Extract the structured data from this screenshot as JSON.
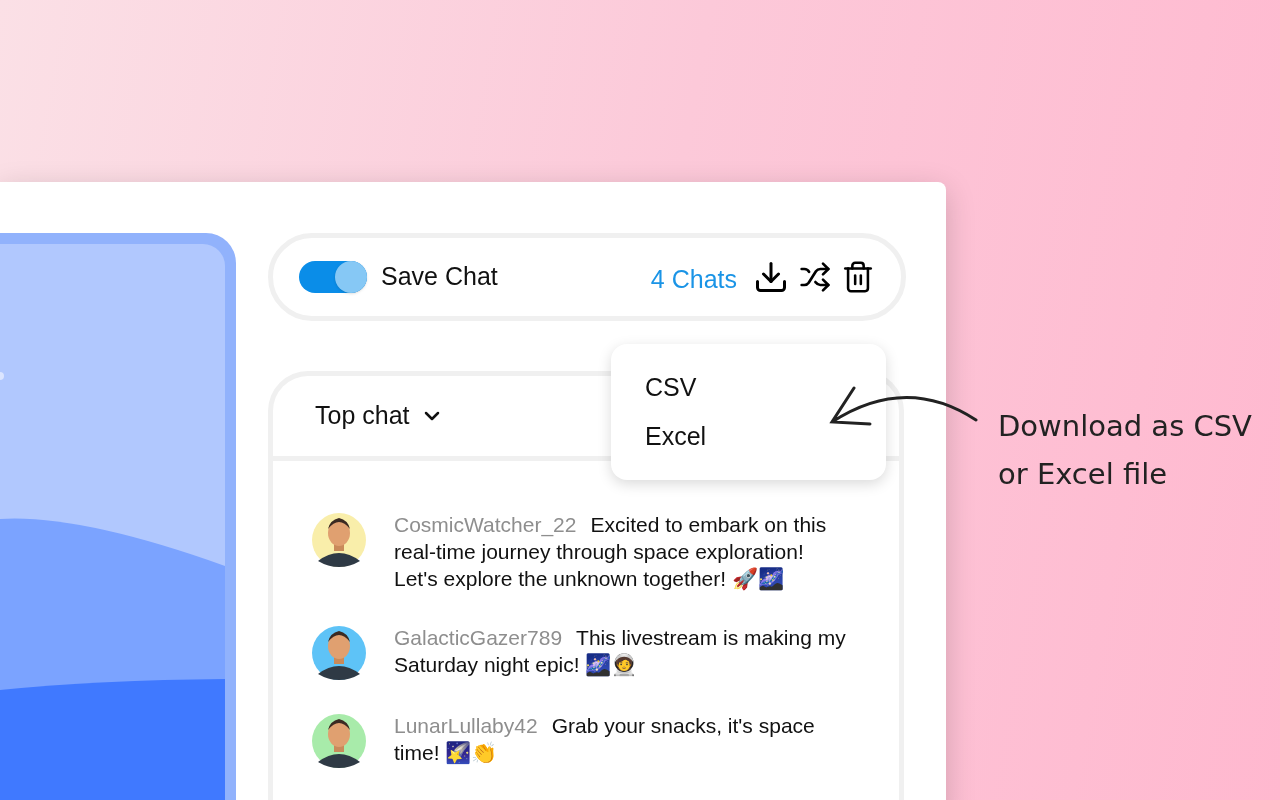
{
  "toolbar": {
    "save_chat": {
      "label": "Save Chat",
      "on": true
    },
    "chat_count": "4 Chats"
  },
  "download_menu": {
    "items": [
      {
        "label": "CSV"
      },
      {
        "label": "Excel"
      }
    ]
  },
  "chat_panel": {
    "filter": "Top chat",
    "messages": [
      {
        "username": "CosmicWatcher_22",
        "text": "Excited to embark on this real-time journey through space exploration! Let's explore the unknown together! 🚀🌌",
        "color": "#f9eeaa"
      },
      {
        "username": "GalacticGazer789",
        "text": "This livestream is making my Saturday night epic!  🌌🧑‍🚀",
        "color": "#5ec3f7"
      },
      {
        "username": "LunarLullaby42",
        "text": "Grab your snacks, it's space time! 🌠👏",
        "color": "#a8ebaa"
      }
    ]
  },
  "annotation": {
    "lines": [
      "Download as CSV",
      "or Excel file"
    ]
  }
}
